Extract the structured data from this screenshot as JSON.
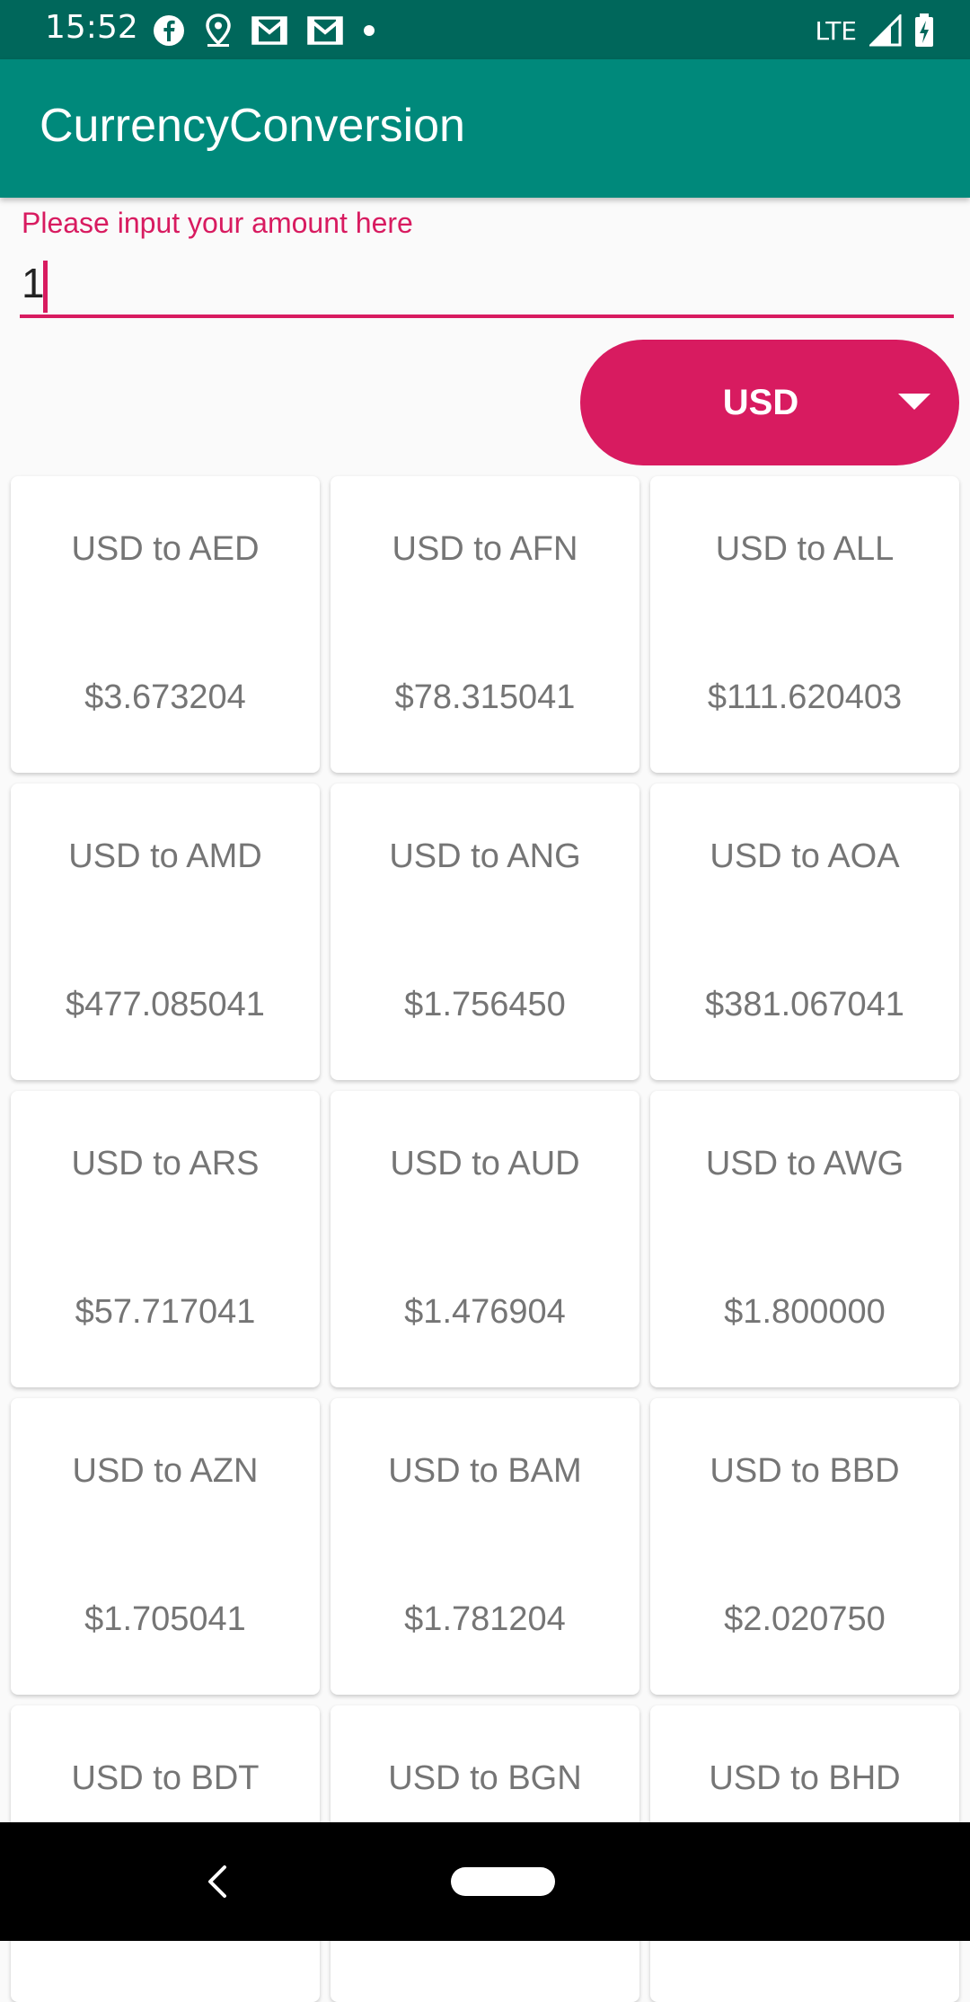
{
  "status_bar": {
    "time": "15:52",
    "network": "LTE",
    "icons": [
      "facebook-icon",
      "location-icon",
      "gmail-icon",
      "gmail-icon",
      "dot-icon",
      "signal-icon",
      "battery-icon"
    ]
  },
  "app_bar": {
    "title": "CurrencyConversion",
    "color": "#00897b"
  },
  "amount_field": {
    "label": "Please input your amount here",
    "value": "1",
    "accent": "#d81b60"
  },
  "currency_selector": {
    "selected": "USD",
    "color": "#d81b60"
  },
  "conversions": [
    {
      "title": "USD to AED",
      "rate": "$3.673204"
    },
    {
      "title": "USD to AFN",
      "rate": "$78.315041"
    },
    {
      "title": "USD to ALL",
      "rate": "$111.620403"
    },
    {
      "title": "USD to AMD",
      "rate": "$477.085041"
    },
    {
      "title": "USD to ANG",
      "rate": "$1.756450"
    },
    {
      "title": "USD to AOA",
      "rate": "$381.067041"
    },
    {
      "title": "USD to ARS",
      "rate": "$57.717041"
    },
    {
      "title": "USD to AUD",
      "rate": "$1.476904"
    },
    {
      "title": "USD to AWG",
      "rate": "$1.800000"
    },
    {
      "title": "USD to AZN",
      "rate": "$1.705041"
    },
    {
      "title": "USD to BAM",
      "rate": "$1.781204"
    },
    {
      "title": "USD to BBD",
      "rate": "$2.020750"
    },
    {
      "title": "USD to BDT",
      "rate": ""
    },
    {
      "title": "USD to BGN",
      "rate": ""
    },
    {
      "title": "USD to BHD",
      "rate": ""
    }
  ]
}
